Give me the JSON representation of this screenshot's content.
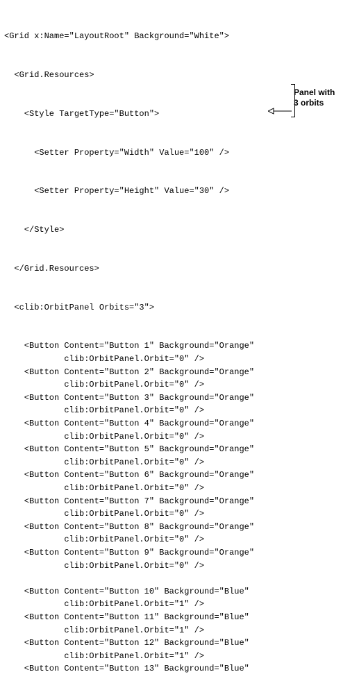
{
  "code": {
    "grid_open": "<Grid x:Name=\"LayoutRoot\" Background=\"White\">",
    "res_open": "  <Grid.Resources>",
    "style_open": "    <Style TargetType=\"Button\">",
    "setter_w": "      <Setter Property=\"Width\" Value=\"100\" />",
    "setter_h": "      <Setter Property=\"Height\" Value=\"30\" />",
    "style_close": "    </Style>",
    "res_close": "  </Grid.Resources>",
    "panel_open": "  <clib:OrbitPanel Orbits=\"3\">"
  },
  "buttons": [
    {
      "l1": "    <Button Content=\"Button 1\" Background=\"Orange\"",
      "l2": "            clib:OrbitPanel.Orbit=\"0\" />"
    },
    {
      "l1": "    <Button Content=\"Button 2\" Background=\"Orange\"",
      "l2": "            clib:OrbitPanel.Orbit=\"0\" />"
    },
    {
      "l1": "    <Button Content=\"Button 3\" Background=\"Orange\"",
      "l2": "            clib:OrbitPanel.Orbit=\"0\" />"
    },
    {
      "l1": "    <Button Content=\"Button 4\" Background=\"Orange\"",
      "l2": "            clib:OrbitPanel.Orbit=\"0\" />"
    },
    {
      "l1": "    <Button Content=\"Button 5\" Background=\"Orange\"",
      "l2": "            clib:OrbitPanel.Orbit=\"0\" />"
    },
    {
      "l1": "    <Button Content=\"Button 6\" Background=\"Orange\"",
      "l2": "            clib:OrbitPanel.Orbit=\"0\" />"
    },
    {
      "l1": "    <Button Content=\"Button 7\" Background=\"Orange\"",
      "l2": "            clib:OrbitPanel.Orbit=\"0\" />"
    },
    {
      "l1": "    <Button Content=\"Button 8\" Background=\"Orange\"",
      "l2": "            clib:OrbitPanel.Orbit=\"0\" />"
    },
    {
      "l1": "    <Button Content=\"Button 9\" Background=\"Orange\"",
      "l2": "            clib:OrbitPanel.Orbit=\"0\" />"
    },
    {
      "gap": true
    },
    {
      "l1": "    <Button Content=\"Button 10\" Background=\"Blue\"",
      "l2": "            clib:OrbitPanel.Orbit=\"1\" />"
    },
    {
      "l1": "    <Button Content=\"Button 11\" Background=\"Blue\"",
      "l2": "            clib:OrbitPanel.Orbit=\"1\" />"
    },
    {
      "l1": "    <Button Content=\"Button 12\" Background=\"Blue\"",
      "l2": "            clib:OrbitPanel.Orbit=\"1\" />"
    },
    {
      "l1": "    <Button Content=\"Button 13\" Background=\"Blue\"",
      "l2": ""
    }
  ],
  "annotation": {
    "line1": "Panel with",
    "line2": "3 orbits"
  }
}
